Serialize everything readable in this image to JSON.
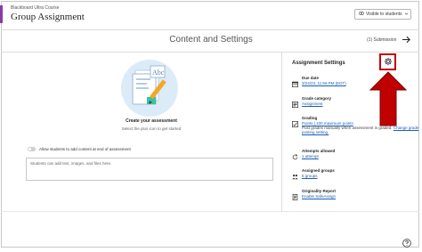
{
  "header": {
    "course": "Blackboard Ultra Course",
    "title": "Group Assignment",
    "visibility": "Visible to students"
  },
  "content": {
    "title": "Content and Settings",
    "submission": "(1) Submission",
    "create_title": "Create your assessment",
    "create_subtitle": "Select the plus icon to get started",
    "allow_label": "Allow students to add content at end of assessment",
    "textbox_placeholder": "Students can add text, images, and files here."
  },
  "settings": {
    "title": "Assignment Settings",
    "due_date": {
      "label": "Due date",
      "value": "3/24/23, 11:59 PM (EDT)"
    },
    "grade_category": {
      "label": "Grade category",
      "value": "Assignment"
    },
    "grading": {
      "label": "Grading",
      "value": "Points | 100 maximum points",
      "note": "Post grades manually when assessment is graded.",
      "note_link": "Change grade posting setting."
    },
    "attempts": {
      "label": "Attempts allowed",
      "value": "1 attempt"
    },
    "groups": {
      "label": "Assigned groups",
      "value": "5 groups"
    },
    "originality": {
      "label": "Originality Report",
      "value": "Enable SafeAssign"
    }
  },
  "colors": {
    "accent": "#8b3aa8",
    "annotation": "#c00000",
    "link": "#1a5fb4"
  }
}
